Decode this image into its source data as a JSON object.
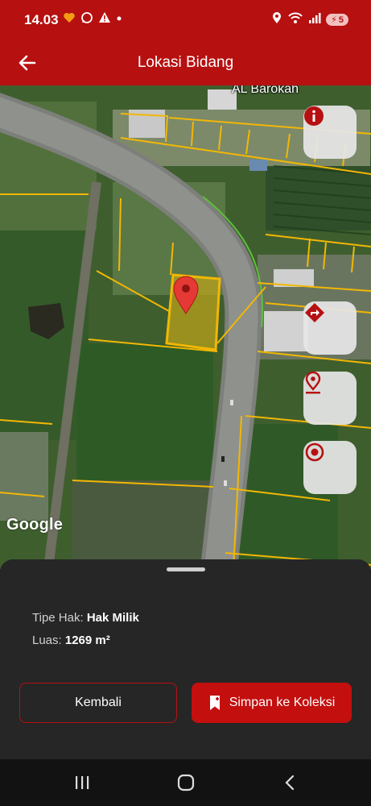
{
  "status_bar": {
    "time": "14.03",
    "battery": "5"
  },
  "app_bar": {
    "title": "Lokasi Bidang"
  },
  "map": {
    "place_label": "AL Barokah",
    "attribution": "Google"
  },
  "sheet": {
    "tipe_hak_label": "Tipe Hak:",
    "tipe_hak_value": "Hak Milik",
    "luas_label": "Luas:",
    "luas_value": "1269 m²",
    "back_label": "Kembali",
    "save_label": "Simpan ke Koleksi"
  },
  "colors": {
    "primary": "#b71010",
    "parcel_line": "#f2b705",
    "sheet_bg": "#262626"
  },
  "icons": [
    "back-arrow-icon",
    "info-icon",
    "directions-icon",
    "location-pin-icon",
    "my-location-icon",
    "bookmark-add-icon"
  ]
}
